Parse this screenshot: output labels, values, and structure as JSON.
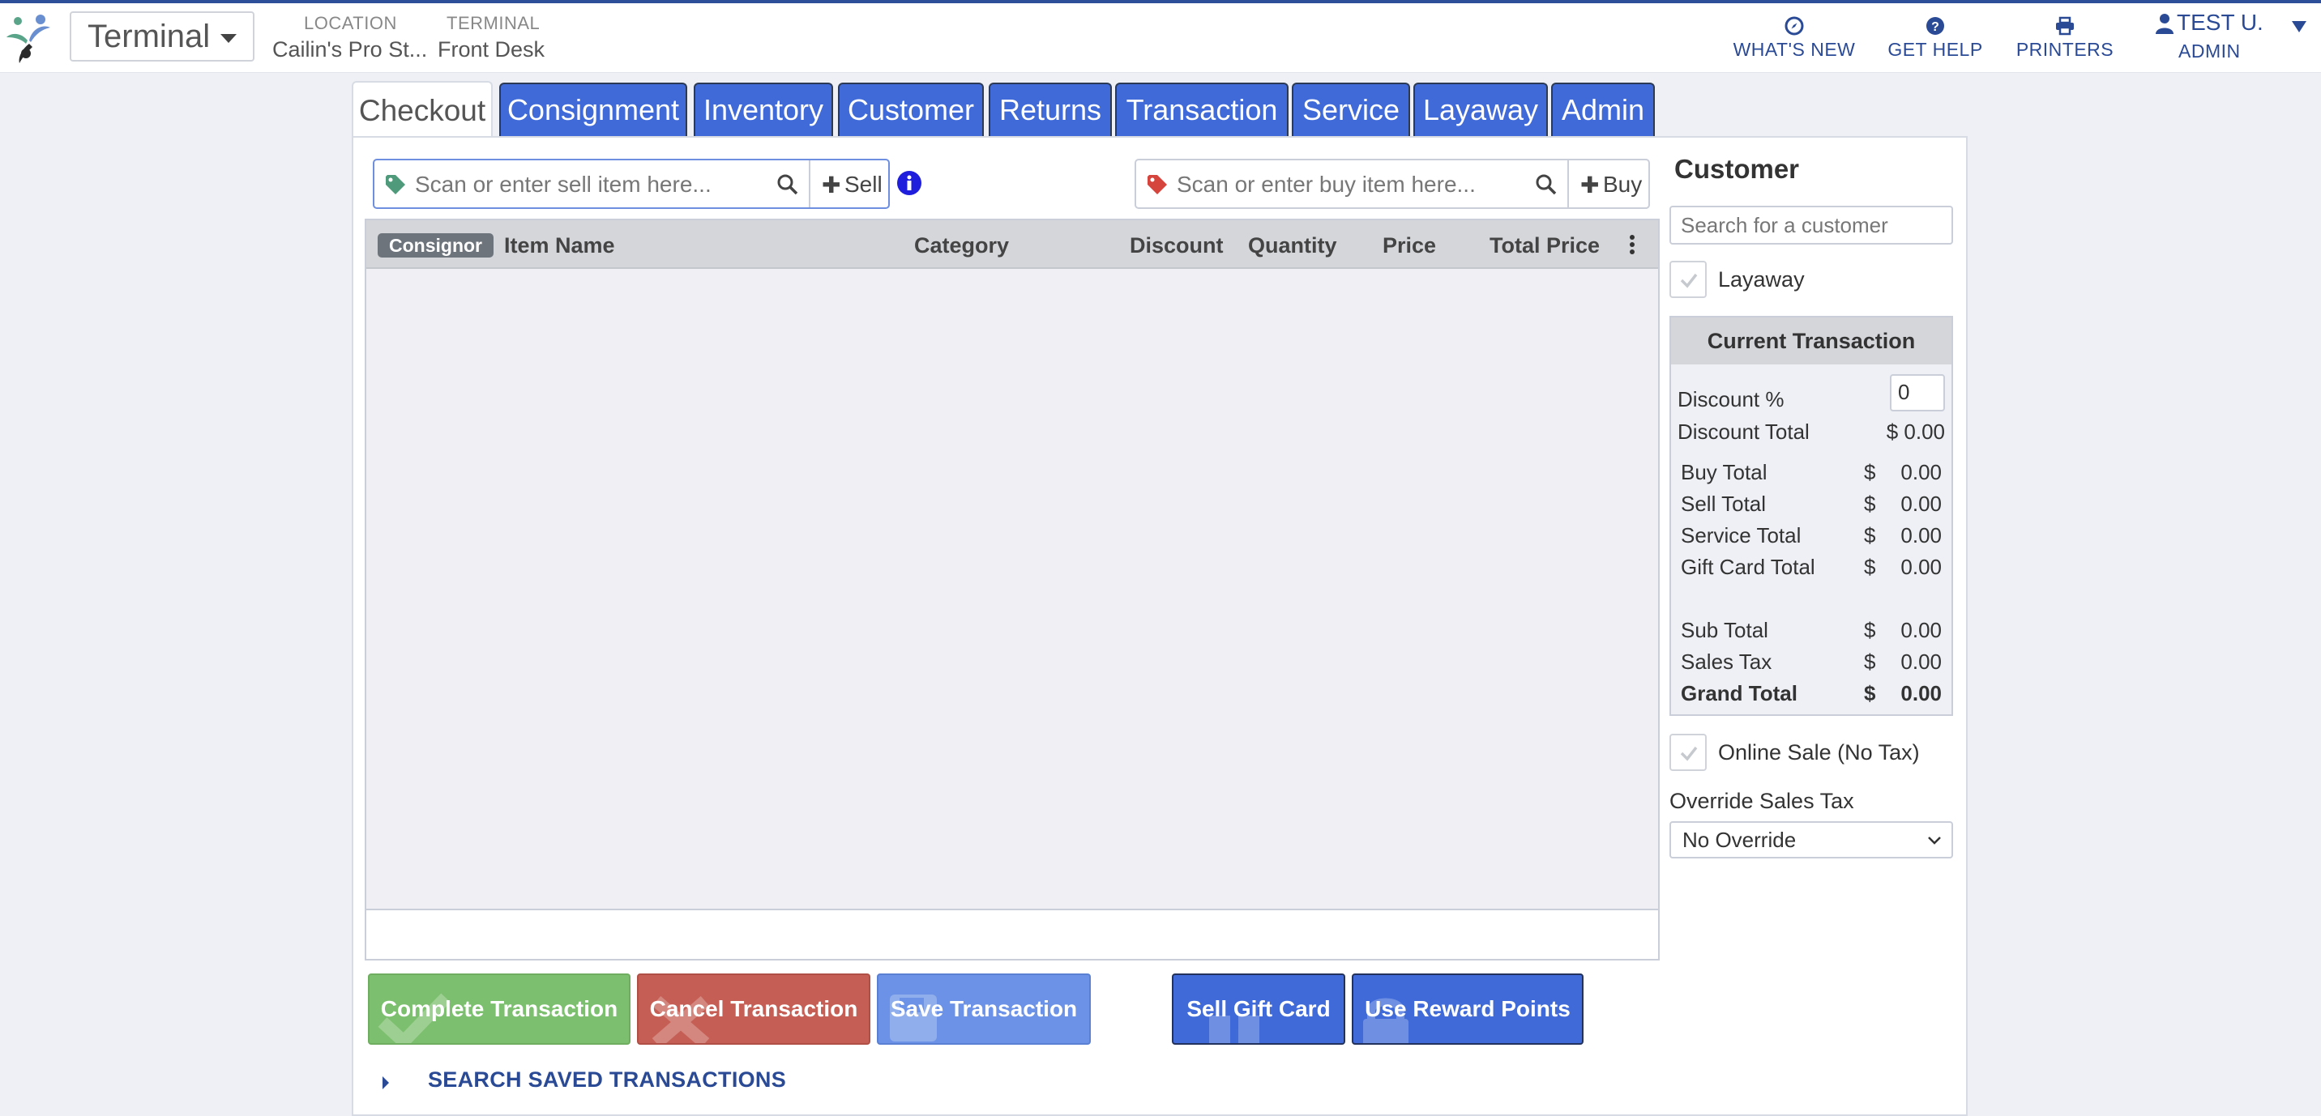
{
  "header": {
    "terminal_select": "Terminal",
    "location_label": "LOCATION",
    "location_value": "Cailin's Pro St...",
    "terminal_label": "TERMINAL",
    "terminal_value": "Front Desk",
    "links": {
      "whats_new": "WHAT'S NEW",
      "get_help": "GET HELP",
      "printers": "PRINTERS"
    },
    "user": {
      "name": "TEST U.",
      "role": "ADMIN"
    }
  },
  "tabs": [
    "Checkout",
    "Consignment",
    "Inventory",
    "Customer",
    "Returns",
    "Transaction",
    "Service",
    "Layaway",
    "Admin"
  ],
  "checkout": {
    "sell_placeholder": "Scan or enter sell item here...",
    "sell_button": "Sell",
    "buy_placeholder": "Scan or enter buy item here...",
    "buy_button": "Buy",
    "columns": {
      "consignor": "Consignor",
      "item_name": "Item Name",
      "category": "Category",
      "discount": "Discount",
      "quantity": "Quantity",
      "price": "Price",
      "total_price": "Total Price"
    },
    "buttons": {
      "complete": "Complete Transaction",
      "cancel": "Cancel Transaction",
      "save": "Save Transaction",
      "sell_gift_card": "Sell Gift Card",
      "use_reward_points": "Use Reward Points"
    },
    "search_saved": "SEARCH SAVED TRANSACTIONS"
  },
  "customer": {
    "title": "Customer",
    "search_placeholder": "Search for a customer",
    "layaway_label": "Layaway",
    "current_transaction": {
      "title": "Current Transaction",
      "discount_pct_label": "Discount %",
      "discount_pct_value": "0",
      "discount_total_label": "Discount Total",
      "discount_total_value": "$ 0.00",
      "currency": "$",
      "rows": [
        {
          "label": "Buy Total",
          "value": "0.00"
        },
        {
          "label": "Sell Total",
          "value": "0.00"
        },
        {
          "label": "Service Total",
          "value": "0.00"
        },
        {
          "label": "Gift Card Total",
          "value": "0.00"
        },
        {
          "label": "Sub Total",
          "value": "0.00"
        },
        {
          "label": "Sales Tax",
          "value": "0.00"
        },
        {
          "label": "Grand Total",
          "value": "0.00"
        }
      ]
    },
    "online_sale_label": "Online Sale (No Tax)",
    "override_label": "Override Sales Tax",
    "override_value": "No Override"
  },
  "colors": {
    "brand_blue": "#3f6ad8",
    "complete_green": "#7cbf6e",
    "cancel_red": "#c55f55",
    "save_blue": "#6b92e6"
  }
}
